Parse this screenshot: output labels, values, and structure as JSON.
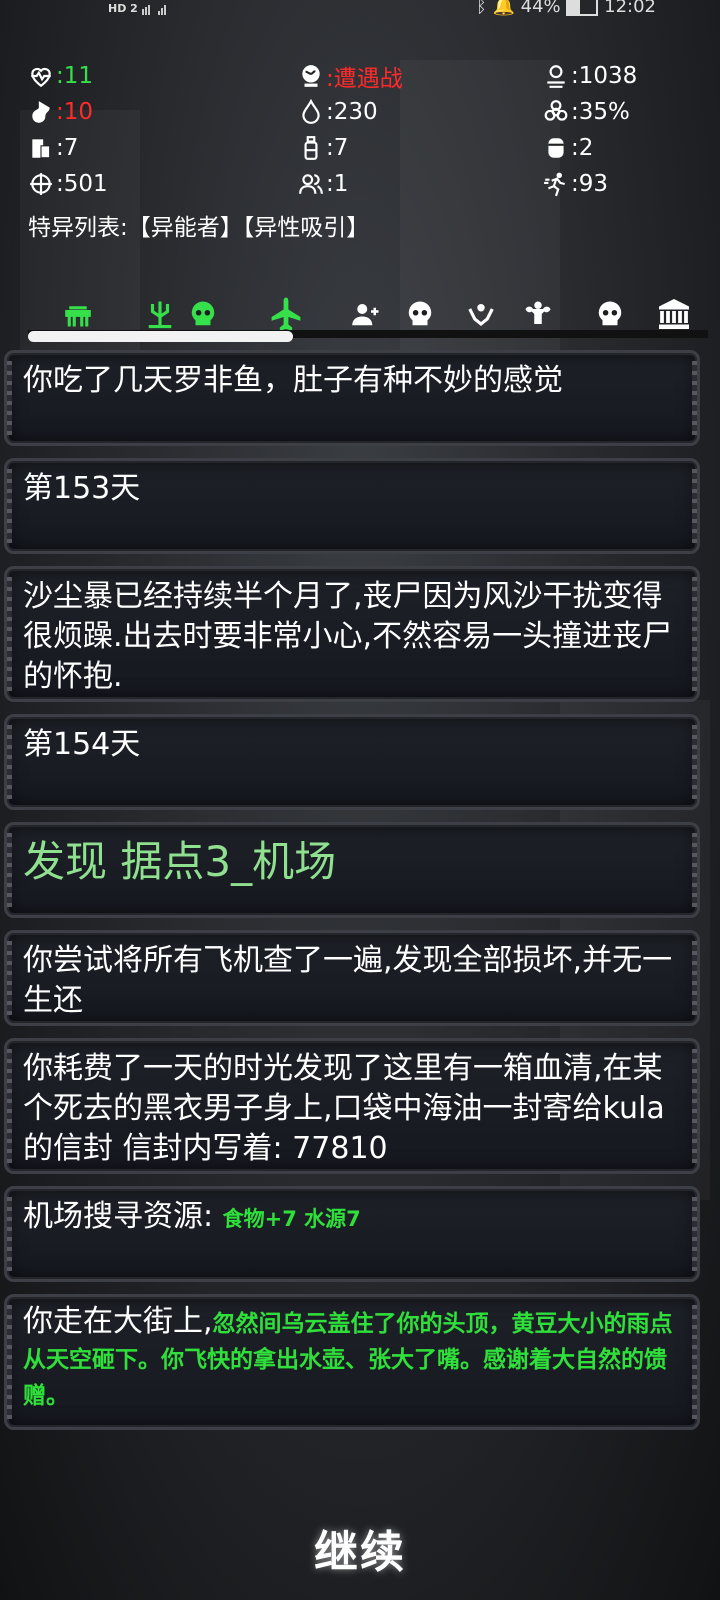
{
  "status_bar": {
    "network": "HD 2",
    "battery": "44%",
    "time": "12:02"
  },
  "stats": {
    "health": ":11",
    "encounter": ":遭遇战",
    "distance": ":1038",
    "hunger": ":10",
    "water": ":230",
    "infection": ":35%",
    "food_cans": ":7",
    "bottles": ":7",
    "gas_can": ":2",
    "aim": ":501",
    "people": ":1",
    "speed": ":93"
  },
  "traits": "特异列表:【异能者】【异性吸引】",
  "colors": {
    "accent_green": "#36e04a",
    "alert_red": "#ff2b2b",
    "progress": "#f2f2f2"
  },
  "tabs": [
    {
      "icon": "gate-icon"
    },
    {
      "icon": "trident-icon"
    },
    {
      "icon": "skull-icon"
    },
    {
      "icon": "airplane-icon"
    },
    {
      "icon": "add-person-icon"
    },
    {
      "icon": "skull-icon"
    },
    {
      "icon": "hands-icon"
    },
    {
      "icon": "muscle-icon"
    },
    {
      "icon": "skull-icon"
    },
    {
      "icon": "bank-icon"
    }
  ],
  "tab_progress": 0.39,
  "log": {
    "entry1": "你吃了几天罗非鱼，肚子有种不妙的感觉",
    "entry2": "第153天",
    "entry3": "沙尘暴已经持续半个月了,丧尸因为风沙干扰变得很烦躁.出去时要非常小心,不然容易一头撞进丧尸的怀抱.",
    "entry4": "第154天",
    "entry5": "发现 据点3_机场",
    "entry6": "你尝试将所有飞机查了一遍,发现全部损坏,并无一生还",
    "entry7": "你耗费了一天的时光发现了这里有一箱血清,在某个死去的黑衣男子身上,口袋中海油一封寄给kula 的信封 信封内写着: 77810",
    "entry8_prefix": "机场搜寻资源:",
    "entry8_loot": "食物+7  水源7",
    "entry9_prefix": "你走在大街上,",
    "entry9_green": "忽然间乌云盖住了你的头顶，黄豆大小的雨点从天空砸下。你飞快的拿出水壶、张大了嘴。感谢着大自然的馈赠。"
  },
  "continue_label": "继续"
}
